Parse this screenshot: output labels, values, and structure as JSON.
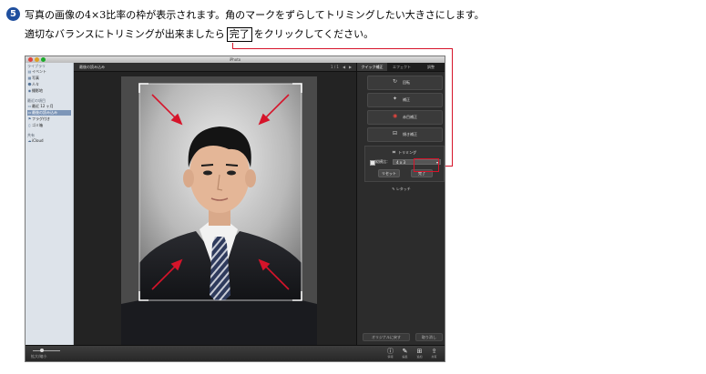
{
  "instruction": {
    "step": "5",
    "line1": "写真の画像の4×3比率の枠が表示されます。角のマークをずらしてトリミングしたい大きさにします。",
    "line2_before": "適切なバランスにトリミングが出来ましたら",
    "line2_boxed": "完了",
    "line2_after": "をクリックしてください。",
    "accent_color": "#d6142a"
  },
  "window": {
    "title": "iPhoto"
  },
  "sidebar": {
    "library_header": "ライブラリ",
    "items": [
      {
        "label": "イベント",
        "icon": "events-icon"
      },
      {
        "label": "写真",
        "icon": "photos-icon"
      },
      {
        "label": "人々",
        "icon": "faces-icon"
      },
      {
        "label": "撮影地",
        "icon": "places-icon"
      }
    ],
    "recent_header": "最近の項目",
    "recent_items": [
      {
        "label": "最近 12 ヶ月",
        "icon": "calendar-icon"
      },
      {
        "label": "最後の読み込み",
        "icon": "import-icon",
        "selected": true
      },
      {
        "label": "フラグ付き",
        "icon": "flag-icon"
      },
      {
        "label": "ゴミ箱",
        "icon": "trash-icon"
      }
    ],
    "shared_header": "共有",
    "shared_items": [
      {
        "label": "iCloud",
        "icon": "icloud-icon"
      }
    ]
  },
  "main": {
    "title": "最後の読み込み",
    "page_indicator": "1 / 1",
    "prev": "◀",
    "next": "▶"
  },
  "right_panel": {
    "tabs": [
      "クイック補正",
      "エフェクト",
      "調整"
    ],
    "active_tab": 0,
    "buttons": [
      {
        "label": "回転",
        "icon": "rotate-icon"
      },
      {
        "label": "補正",
        "icon": "enhance-icon"
      },
      {
        "label": "赤目補正",
        "icon": "red-eye-icon"
      },
      {
        "label": "傾き補正",
        "icon": "straighten-icon"
      }
    ],
    "trim": {
      "title": "トリミング",
      "constrain_label": "縦横比：",
      "constrain_value": "4 x 3",
      "reset_label": "リセット",
      "done_label": "完了"
    },
    "retouch_label": "レタッチ",
    "revert_label": "オリジナルに戻す",
    "undo_label": "取り消し"
  },
  "bottombar": {
    "zoom_label": "拡大/縮小",
    "items": [
      {
        "label": "情報",
        "icon": "info-icon"
      },
      {
        "label": "編集",
        "icon": "edit-icon",
        "active": true
      },
      {
        "label": "追加",
        "icon": "add-icon"
      },
      {
        "label": "共有",
        "icon": "share-icon"
      }
    ]
  }
}
